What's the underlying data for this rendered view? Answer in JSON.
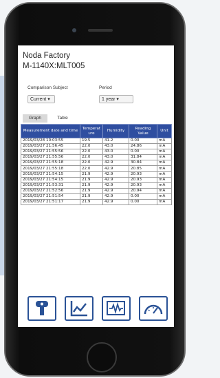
{
  "header": {
    "title_line1": "Noda Factory",
    "title_line2": "M-1140X:MLT005"
  },
  "filters": {
    "comparison_label": "Comparison Subject",
    "comparison_value": "Current ▾",
    "period_label": "Period",
    "period_value": "1 year      ▾"
  },
  "tabs": {
    "graph": "Graph",
    "table": "Table"
  },
  "table": {
    "headers": [
      "Measurement date and time",
      "Temperat ure",
      "Humidity",
      "Reading Value",
      "Unit"
    ],
    "rows": [
      [
        "2019/03/28 10:03:55",
        "19.5",
        "41.2",
        "0.00",
        "mA"
      ],
      [
        "2019/03/27 21:56:45",
        "22.0",
        "43.0",
        "24.86",
        "mA"
      ],
      [
        "2019/03/27 21:55:56",
        "22.0",
        "43.0",
        "0.00",
        "mA"
      ],
      [
        "2019/03/27 21:55:56",
        "22.0",
        "43.0",
        "31.84",
        "mA"
      ],
      [
        "2019/03/27 21:55:18",
        "22.0",
        "42.9",
        "30.84",
        "mA"
      ],
      [
        "2019/03/27 21:55:18",
        "22.0",
        "42.9",
        "20.85",
        "mA"
      ],
      [
        "2019/03/27 21:54:15",
        "21.9",
        "42.9",
        "20.93",
        "mA"
      ],
      [
        "2019/03/27 21:54:15",
        "21.9",
        "42.9",
        "20.93",
        "mA"
      ],
      [
        "2019/03/27 21:53:31",
        "21.9",
        "42.9",
        "20.93",
        "mA"
      ],
      [
        "2019/03/27 21:52:56",
        "21.9",
        "42.9",
        "20.94",
        "mA"
      ],
      [
        "2019/03/27 21:51:54",
        "21.9",
        "42.9",
        "0.00",
        "mA"
      ],
      [
        "2019/03/27 21:51:17",
        "21.9",
        "42.9",
        "0.00",
        "mA"
      ]
    ]
  },
  "nav_icons": [
    "sensor-probe-icon",
    "line-chart-icon",
    "waveform-icon",
    "gauge-icon"
  ],
  "pager": {
    "dots": "●  ○  ○",
    "active_index": 1
  },
  "colors": {
    "accent": "#2a5296",
    "table_header": "#2f4ea0"
  }
}
